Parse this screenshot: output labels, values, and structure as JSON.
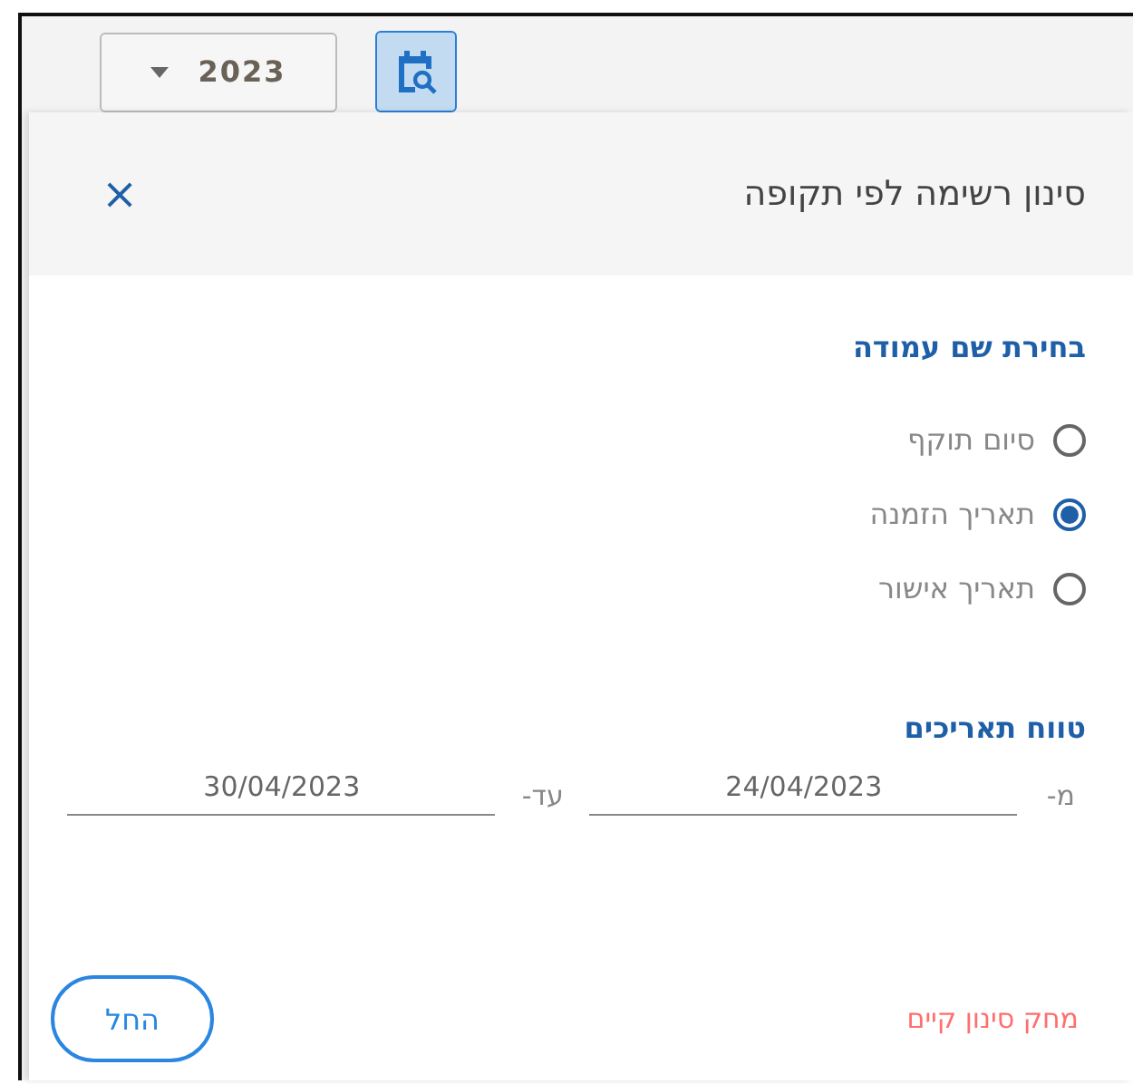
{
  "toolbar": {
    "year": "2023",
    "calendar_button": {
      "selected": true
    }
  },
  "dialog": {
    "title": "סינון רשימה לפי תקופה",
    "close": "×",
    "column_section": {
      "heading": "בחירת שם עמודה",
      "options": [
        {
          "label": "סיום תוקף",
          "selected": false
        },
        {
          "label": "תאריך הזמנה",
          "selected": true
        },
        {
          "label": "תאריך אישור",
          "selected": false
        }
      ]
    },
    "range_section": {
      "heading": "טווח תאריכים",
      "from_label": "מ-",
      "from_value": "24/04/2023",
      "to_label": "עד-",
      "to_value": "30/04/2023"
    },
    "clear_link": "מחק סינון קיים",
    "apply_button": "החל"
  }
}
